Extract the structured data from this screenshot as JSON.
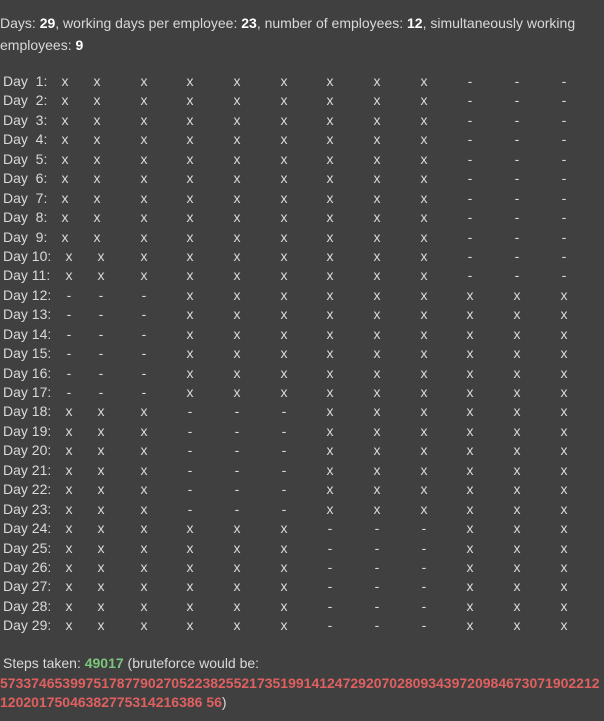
{
  "summary": {
    "days_label": "Days: ",
    "days_value": "29",
    "working_label": ", working days per employee: ",
    "working_value": "23",
    "employees_label": ", number of employees: ",
    "employees_value": "12",
    "simultaneous_label": ", simultaneously working employees: ",
    "simultaneous_value": "9"
  },
  "schedule": [
    {
      "day": "Day  1:",
      "cells": [
        "x",
        "x",
        "x",
        "x",
        "x",
        "x",
        "x",
        "x",
        "x",
        "-",
        "-",
        "-"
      ]
    },
    {
      "day": "Day  2:",
      "cells": [
        "x",
        "x",
        "x",
        "x",
        "x",
        "x",
        "x",
        "x",
        "x",
        "-",
        "-",
        "-"
      ]
    },
    {
      "day": "Day  3:",
      "cells": [
        "x",
        "x",
        "x",
        "x",
        "x",
        "x",
        "x",
        "x",
        "x",
        "-",
        "-",
        "-"
      ]
    },
    {
      "day": "Day  4:",
      "cells": [
        "x",
        "x",
        "x",
        "x",
        "x",
        "x",
        "x",
        "x",
        "x",
        "-",
        "-",
        "-"
      ]
    },
    {
      "day": "Day  5:",
      "cells": [
        "x",
        "x",
        "x",
        "x",
        "x",
        "x",
        "x",
        "x",
        "x",
        "-",
        "-",
        "-"
      ]
    },
    {
      "day": "Day  6:",
      "cells": [
        "x",
        "x",
        "x",
        "x",
        "x",
        "x",
        "x",
        "x",
        "x",
        "-",
        "-",
        "-"
      ]
    },
    {
      "day": "Day  7:",
      "cells": [
        "x",
        "x",
        "x",
        "x",
        "x",
        "x",
        "x",
        "x",
        "x",
        "-",
        "-",
        "-"
      ]
    },
    {
      "day": "Day  8:",
      "cells": [
        "x",
        "x",
        "x",
        "x",
        "x",
        "x",
        "x",
        "x",
        "x",
        "-",
        "-",
        "-"
      ]
    },
    {
      "day": "Day  9:",
      "cells": [
        "x",
        "x",
        "x",
        "x",
        "x",
        "x",
        "x",
        "x",
        "x",
        "-",
        "-",
        "-"
      ]
    },
    {
      "day": "Day 10:",
      "cells": [
        "x",
        "x",
        "x",
        "x",
        "x",
        "x",
        "x",
        "x",
        "x",
        "-",
        "-",
        "-"
      ]
    },
    {
      "day": "Day 11:",
      "cells": [
        "x",
        "x",
        "x",
        "x",
        "x",
        "x",
        "x",
        "x",
        "x",
        "-",
        "-",
        "-"
      ]
    },
    {
      "day": "Day 12:",
      "cells": [
        "-",
        "-",
        "-",
        "x",
        "x",
        "x",
        "x",
        "x",
        "x",
        "x",
        "x",
        "x"
      ]
    },
    {
      "day": "Day 13:",
      "cells": [
        "-",
        "-",
        "-",
        "x",
        "x",
        "x",
        "x",
        "x",
        "x",
        "x",
        "x",
        "x"
      ]
    },
    {
      "day": "Day 14:",
      "cells": [
        "-",
        "-",
        "-",
        "x",
        "x",
        "x",
        "x",
        "x",
        "x",
        "x",
        "x",
        "x"
      ]
    },
    {
      "day": "Day 15:",
      "cells": [
        "-",
        "-",
        "-",
        "x",
        "x",
        "x",
        "x",
        "x",
        "x",
        "x",
        "x",
        "x"
      ]
    },
    {
      "day": "Day 16:",
      "cells": [
        "-",
        "-",
        "-",
        "x",
        "x",
        "x",
        "x",
        "x",
        "x",
        "x",
        "x",
        "x"
      ]
    },
    {
      "day": "Day 17:",
      "cells": [
        "-",
        "-",
        "-",
        "x",
        "x",
        "x",
        "x",
        "x",
        "x",
        "x",
        "x",
        "x"
      ]
    },
    {
      "day": "Day 18:",
      "cells": [
        "x",
        "x",
        "x",
        "-",
        "-",
        "-",
        "x",
        "x",
        "x",
        "x",
        "x",
        "x"
      ]
    },
    {
      "day": "Day 19:",
      "cells": [
        "x",
        "x",
        "x",
        "-",
        "-",
        "-",
        "x",
        "x",
        "x",
        "x",
        "x",
        "x"
      ]
    },
    {
      "day": "Day 20:",
      "cells": [
        "x",
        "x",
        "x",
        "-",
        "-",
        "-",
        "x",
        "x",
        "x",
        "x",
        "x",
        "x"
      ]
    },
    {
      "day": "Day 21:",
      "cells": [
        "x",
        "x",
        "x",
        "-",
        "-",
        "-",
        "x",
        "x",
        "x",
        "x",
        "x",
        "x"
      ]
    },
    {
      "day": "Day 22:",
      "cells": [
        "x",
        "x",
        "x",
        "-",
        "-",
        "-",
        "x",
        "x",
        "x",
        "x",
        "x",
        "x"
      ]
    },
    {
      "day": "Day 23:",
      "cells": [
        "x",
        "x",
        "x",
        "-",
        "-",
        "-",
        "x",
        "x",
        "x",
        "x",
        "x",
        "x"
      ]
    },
    {
      "day": "Day 24:",
      "cells": [
        "x",
        "x",
        "x",
        "x",
        "x",
        "x",
        "-",
        "-",
        "-",
        "x",
        "x",
        "x"
      ]
    },
    {
      "day": "Day 25:",
      "cells": [
        "x",
        "x",
        "x",
        "x",
        "x",
        "x",
        "-",
        "-",
        "-",
        "x",
        "x",
        "x"
      ]
    },
    {
      "day": "Day 26:",
      "cells": [
        "x",
        "x",
        "x",
        "x",
        "x",
        "x",
        "-",
        "-",
        "-",
        "x",
        "x",
        "x"
      ]
    },
    {
      "day": "Day 27:",
      "cells": [
        "x",
        "x",
        "x",
        "x",
        "x",
        "x",
        "-",
        "-",
        "-",
        "x",
        "x",
        "x"
      ]
    },
    {
      "day": "Day 28:",
      "cells": [
        "x",
        "x",
        "x",
        "x",
        "x",
        "x",
        "-",
        "-",
        "-",
        "x",
        "x",
        "x"
      ]
    },
    {
      "day": "Day 29:",
      "cells": [
        "x",
        "x",
        "x",
        "x",
        "x",
        "x",
        "-",
        "-",
        "-",
        "x",
        "x",
        "x"
      ]
    }
  ],
  "footer": {
    "steps_label": "Steps taken: ",
    "steps_value": "49017",
    "brute_open": " (bruteforce would be: ",
    "brute_value": "5733746539975178779027052238255217351991412472920702809343972098467307190221212020175046382775314216386 56",
    "brute_close": ")"
  },
  "colors": {
    "background": "#404040",
    "text": "#d9d9d9",
    "steps": "#7bc67b",
    "bruteforce": "#e06060"
  }
}
